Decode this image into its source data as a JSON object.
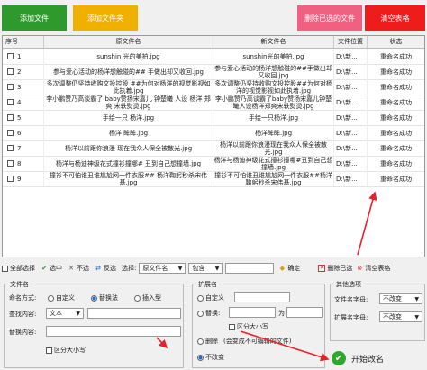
{
  "top_buttons": {
    "add_file": "添加文件",
    "add_folder": "添加文件夹",
    "delete_selected": "删除已选的文件",
    "clear_table": "清空表格"
  },
  "table": {
    "headers": [
      "序号",
      "原文件名",
      "新文件名",
      "文件位置",
      "状态"
    ],
    "rows": [
      {
        "no": "1",
        "orig": "sunshin 光的美拍.jpg",
        "new": "sunshin光的美拍.jpg",
        "loc": "D:\\新...",
        "status": "重命名成功"
      },
      {
        "no": "2",
        "orig": "参与爱心活动的杨洋想触碰的## 手做出却又收回.jpg",
        "new": "参与爱心活动的杨洋想触碰的##手做出却又收回.jpg",
        "loc": "D:\\新...",
        "status": "重命名成功"
      },
      {
        "no": "3",
        "orig": "多次调整仍坚持收购文投控股 ##为何对杨洋的视觉影视如此执着.jpg",
        "new": "多次调整仍坚持收购文投控股##为何对杨洋的视觉影视如此执着.jpg",
        "loc": "D:\\新...",
        "status": "重命名成功"
      },
      {
        "no": "4",
        "orig": "李小鹏赞乃高谈霸了 baby赞扬宋嘉儿 钟楚曦 人设 杨洋 郑爽 宋轶熨烫.jpg",
        "new": "李小鹏赞乃高谈霸了baby赞扬宋嘉儿钟楚曦人设杨洋郑爽宋轶熨烫.jpg",
        "loc": "D:\\新...",
        "status": "重命名成功"
      },
      {
        "no": "5",
        "orig": "手绘一只 杨洋.jpg",
        "new": "手绘一只杨洋.jpg",
        "loc": "D:\\新...",
        "status": "重命名成功"
      },
      {
        "no": "6",
        "orig": "杨洋 眸眸.jpg",
        "new": "杨洋眸眸.jpg",
        "loc": "D:\\新...",
        "status": "重命名成功"
      },
      {
        "no": "7",
        "orig": "杨洋以前跟你浪漫 现在我众人保全被散光.jpg",
        "new": "杨洋以前跟你浪漫现在我众人保全被散光.jpg",
        "loc": "D:\\新...",
        "status": "重命名成功"
      },
      {
        "no": "8",
        "orig": "杨洋与杨迪神级花式撞衫撞哪# 丑到自己想撞墙.jpg",
        "new": "杨洋与杨迪神级花式撞衫撞哪#丑到自己想撞墙.jpg",
        "loc": "D:\\新...",
        "status": "重命名成功"
      },
      {
        "no": "9",
        "orig": "撞衫不可怕谁丑谁尴尬网一件衣服## 杨洋鞠躬秒杀宋伟基.jpg",
        "new": "撞衫不可怕谁丑谁尴尬网一件衣服##杨洋鞠躬秒杀宋伟基.jpg",
        "loc": "D:\\新...",
        "status": "重命名成功"
      }
    ]
  },
  "toolbar": {
    "select_all": "全部选择",
    "select_middle": "选中",
    "deselect": "不选",
    "invert": "反选",
    "select_by": "选择:",
    "field_value": "原文件名",
    "match_value": "包含",
    "confirm": "确定",
    "delete_selected": "删除已选",
    "clear_table": "清空表格"
  },
  "filename_panel": {
    "title": "文件名",
    "mode_label": "命名方式:",
    "custom": "自定义",
    "replace": "替换法",
    "insert": "插入型",
    "find_label": "查找内容:",
    "find_type": "文本",
    "replace_label": "替换内容:",
    "case": "区分大小写"
  },
  "ext_panel": {
    "title": "扩展名",
    "custom": "自定义",
    "replace": "替换:",
    "to": "为",
    "case": "区分大小写",
    "delete": "删除",
    "delete_note": "(会变成不可编辑的文件)",
    "unchanged": "不改变"
  },
  "other_panel": {
    "title": "其他选项",
    "name_case_label": "文件名字母:",
    "name_case_value": "不改变",
    "ext_case_label": "扩展名字母:",
    "ext_case_value": "不改变"
  },
  "start_button": "开始改名",
  "colors": {
    "add_file": "#2e9a2e",
    "add_folder": "#f0b000",
    "delete_selected": "#f06080",
    "clear_table": "#ef1c1c",
    "arrow": "#e8202a",
    "start_icon": "#2ca82c"
  }
}
